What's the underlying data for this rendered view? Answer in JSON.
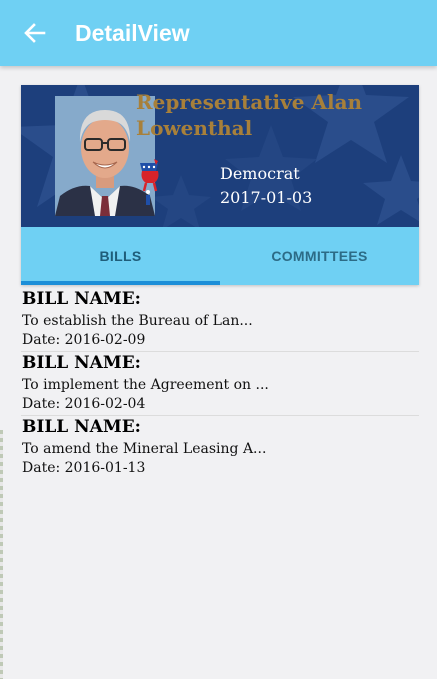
{
  "appbar": {
    "title": "DetailView",
    "back_icon": "arrow-left-icon",
    "color": "#6fd0f3"
  },
  "profile": {
    "name": "Representative Alan Lowenthal",
    "party": "Democrat",
    "party_icon": "democrat-donkey-icon",
    "term_start": "2017-01-03",
    "banner_color": "#1d3f7c",
    "name_color": "#a8803a"
  },
  "tabs": [
    {
      "label": "BILLS",
      "active": true
    },
    {
      "label": "COMMITTEES",
      "active": false
    }
  ],
  "bills": [
    {
      "heading": "BILL NAME:",
      "title": "To establish the Bureau of Lan...",
      "date": "Date: 2016-02-09"
    },
    {
      "heading": "BILL NAME:",
      "title": "To implement the Agreement on ...",
      "date": "Date: 2016-02-04"
    },
    {
      "heading": "BILL NAME:",
      "title": "To amend the Mineral Leasing A...",
      "date": "Date: 2016-01-13"
    }
  ]
}
